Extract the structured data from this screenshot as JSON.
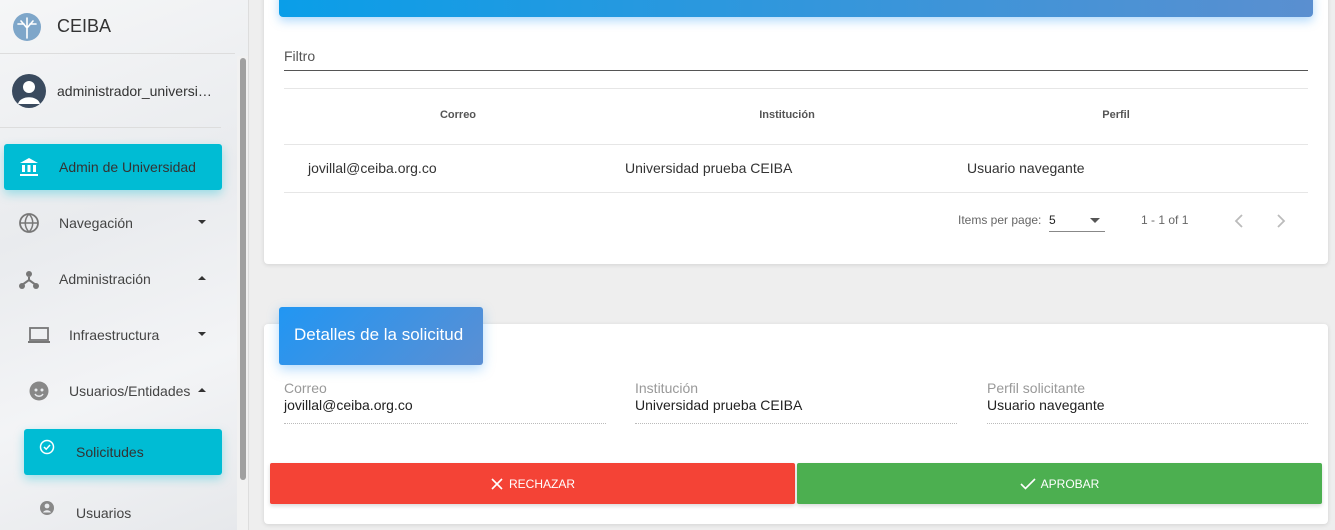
{
  "brand": {
    "name": "CEIBA",
    "logo": "ceiba-tree-logo"
  },
  "user": {
    "name": "administrador_universid…",
    "icon": "account-icon"
  },
  "nav": {
    "admin_universidad": "Admin de Universidad",
    "navegacion": "Navegación",
    "administracion": "Administración",
    "infraestructura": "Infraestructura",
    "usuarios_entidades": "Usuarios/Entidades",
    "solicitudes": "Solicitudes",
    "usuarios": "Usuarios"
  },
  "table": {
    "filter_label": "Filtro",
    "columns": [
      "Correo",
      "Institución",
      "Perfil"
    ],
    "rows": [
      {
        "correo": "jovillal@ceiba.org.co",
        "institucion": "Universidad prueba CEIBA",
        "perfil": "Usuario navegante"
      }
    ],
    "paginator": {
      "items_per_page_label": "Items per page:",
      "items_per_page": "5",
      "range": "1 - 1 of 1"
    }
  },
  "details": {
    "title": "Detalles de la solicitud",
    "fields": [
      {
        "label": "Correo",
        "value": "jovillal@ceiba.org.co"
      },
      {
        "label": "Institución",
        "value": "Universidad prueba CEIBA"
      },
      {
        "label": "Perfil solicitante",
        "value": "Usuario navegante"
      }
    ],
    "reject_label": "RECHAZAR",
    "approve_label": "APROBAR"
  },
  "colors": {
    "active": "#00bcd4",
    "reject": "#f44336",
    "approve": "#4caf50",
    "header": "#2196f3"
  }
}
